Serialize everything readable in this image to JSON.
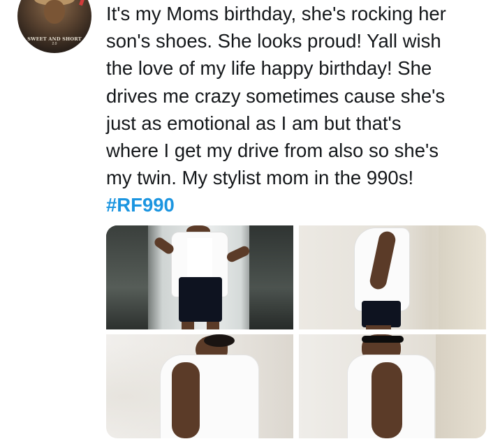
{
  "tweet": {
    "lines": [
      "It's my Moms birthday, she's rocking her",
      "son's shoes. She looks proud! Yall wish",
      "the love of my life happy birthday! She",
      "drives me crazy sometimes cause she's",
      "just as emotional as I am but that's",
      "where I get my drive from also so she's",
      "my twin. My stylist mom in the 990s!"
    ],
    "hashtag": "#RF990"
  },
  "avatar": {
    "brand": "SWEET AND SHORT",
    "brand_sub": "2.0"
  },
  "media": {
    "count": 4
  },
  "colors": {
    "text": "#14171a",
    "hashtag": "#1b95e0",
    "background": "#ffffff"
  }
}
